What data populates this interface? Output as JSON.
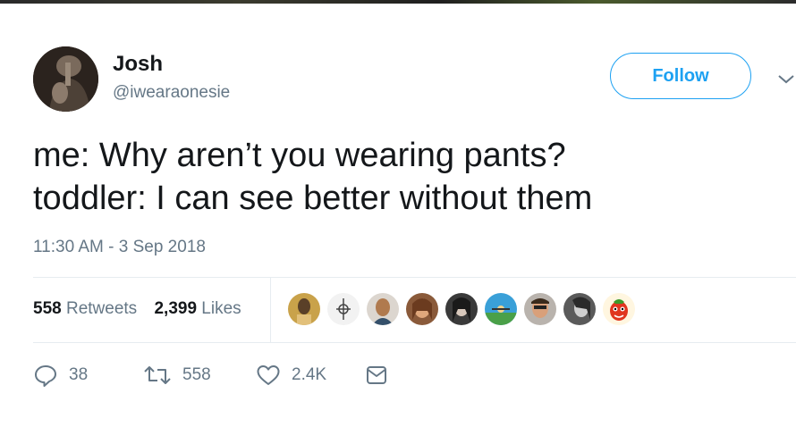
{
  "author": {
    "name": "Josh",
    "handle": "@iwearaonesie"
  },
  "follow_label": "Follow",
  "tweet": {
    "lines": [
      "me: Why aren’t you wearing pants?",
      "toddler: I can see better without them"
    ],
    "timestamp": "11:30 AM - 3 Sep 2018"
  },
  "stats": {
    "retweets_count": "558",
    "retweets_label": "Retweets",
    "likes_count": "2,399",
    "likes_label": "Likes"
  },
  "actions": {
    "replies": "38",
    "retweets": "558",
    "likes": "2.4K"
  },
  "colors": {
    "accent": "#1da1f2",
    "secondary_text": "#657786",
    "primary_text": "#14171a",
    "divider": "#e6ecf0",
    "like_heart": "#e0245e"
  },
  "icons": [
    "chevron-down-icon",
    "reply-icon",
    "retweet-icon",
    "like-icon",
    "direct-message-icon"
  ]
}
